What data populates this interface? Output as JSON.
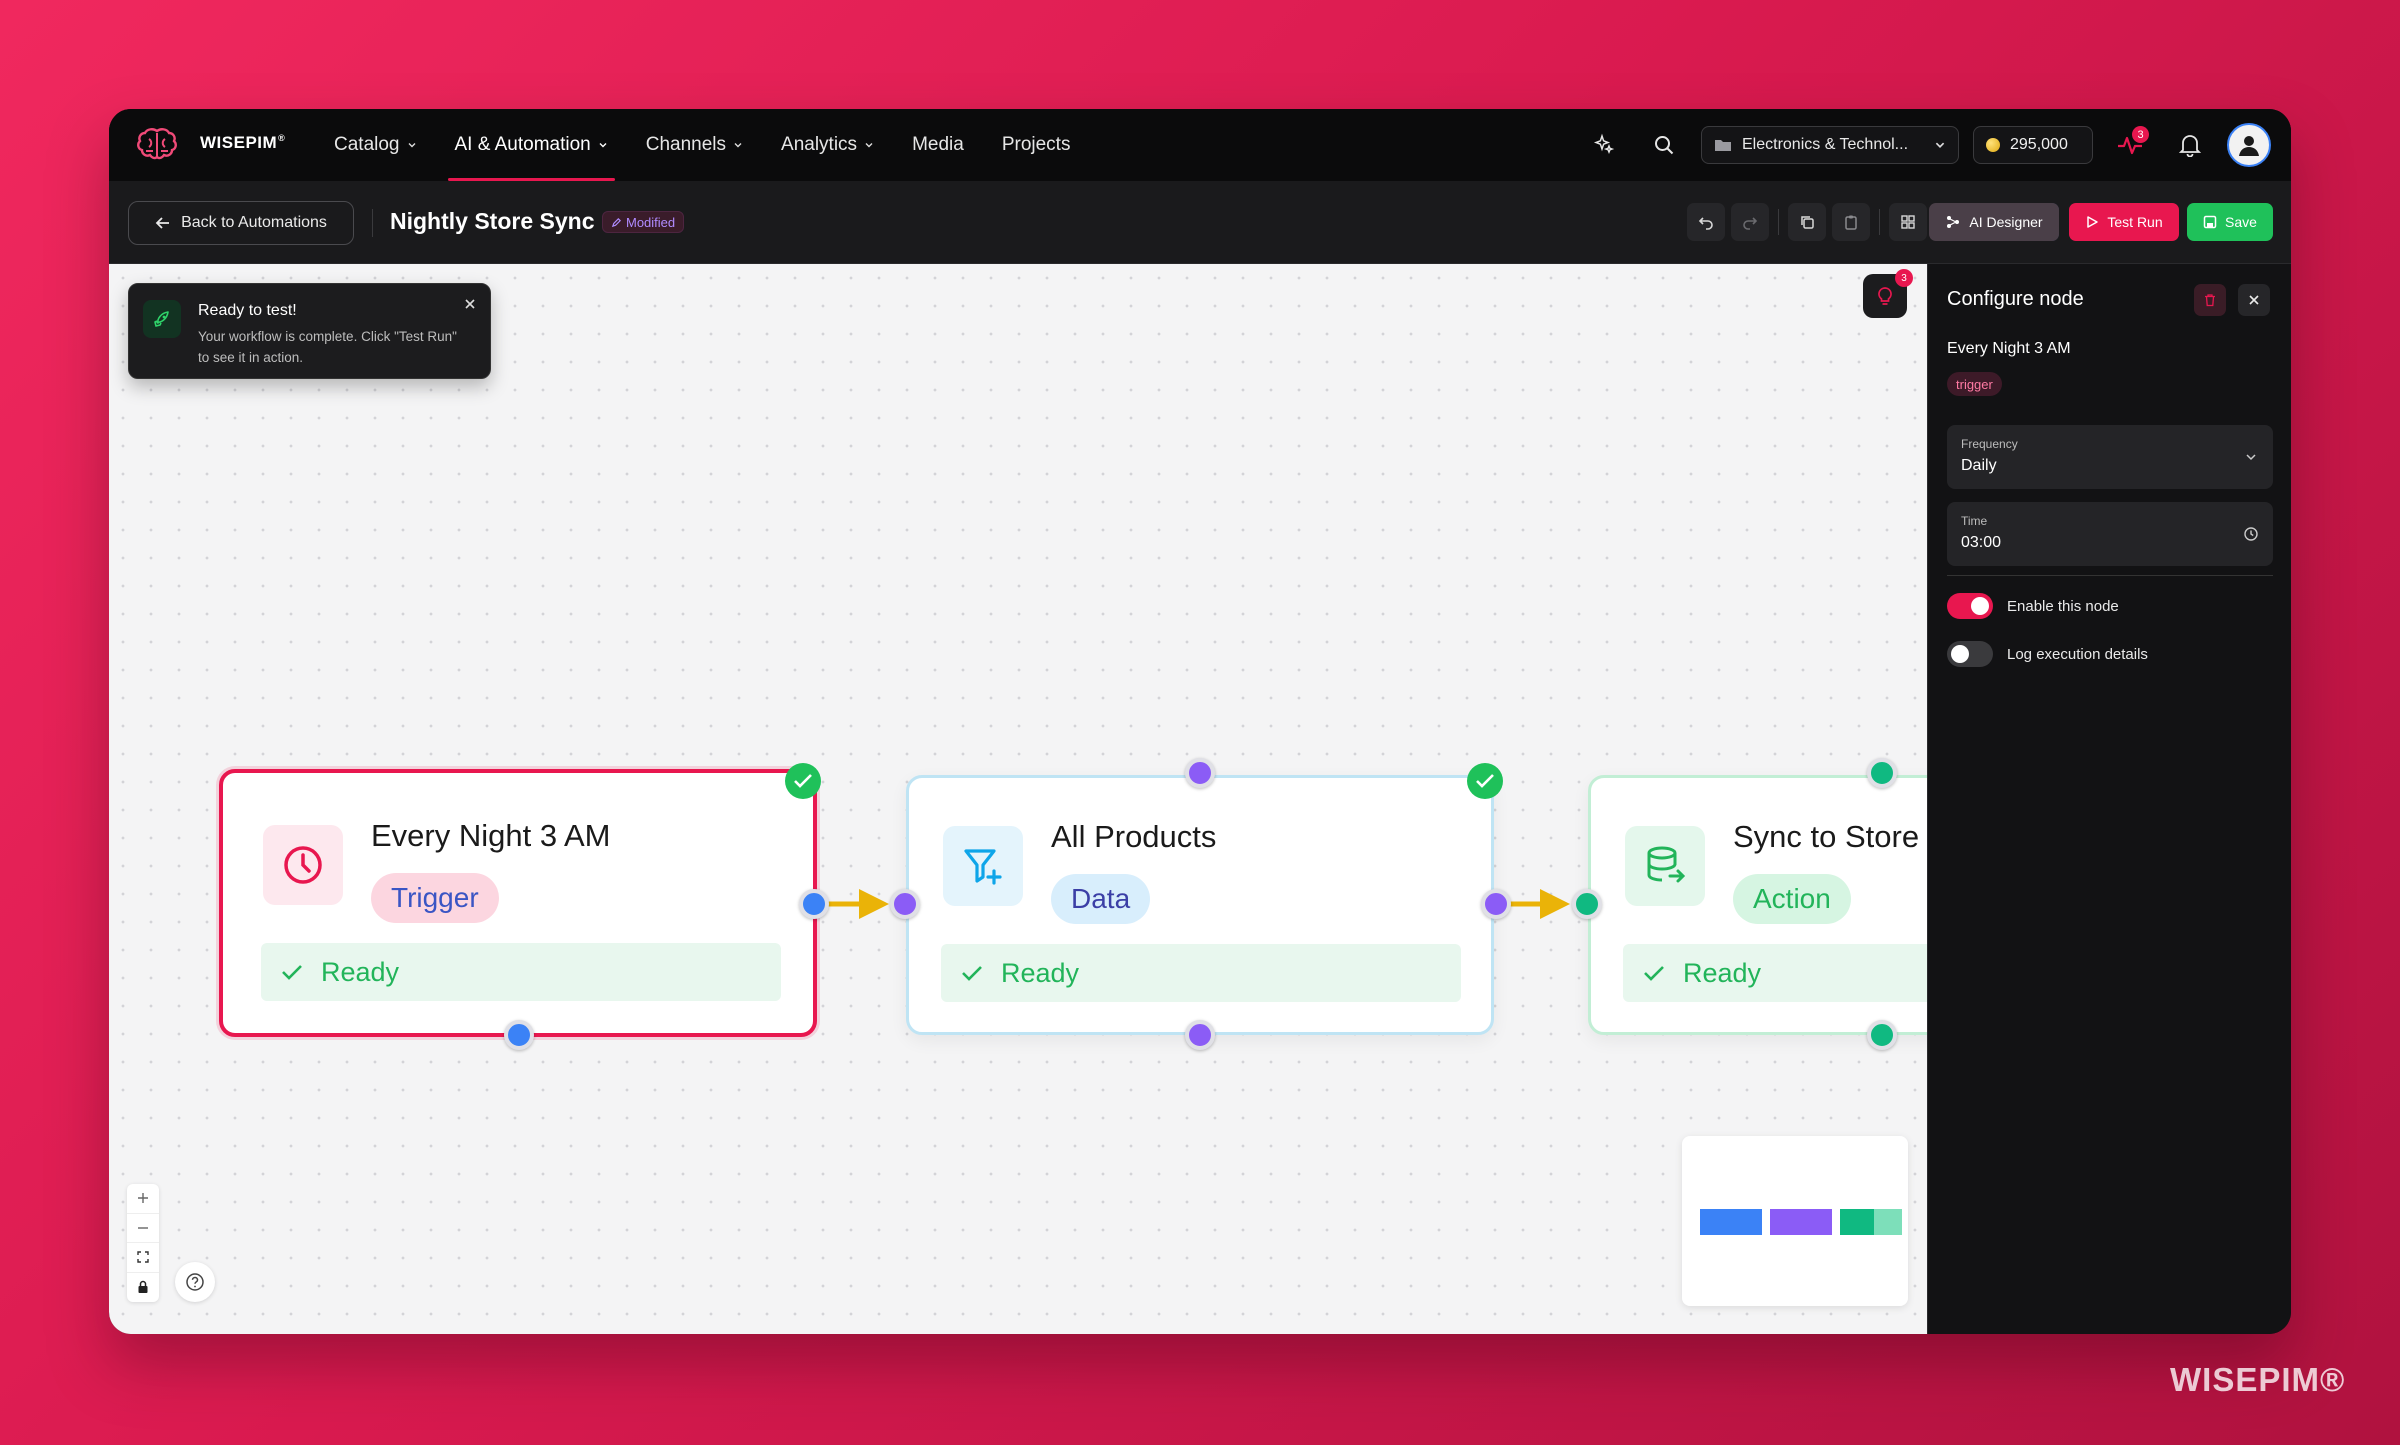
{
  "brand": {
    "name": "WISEPIM",
    "mark": "®"
  },
  "nav": {
    "items": [
      {
        "label": "Catalog",
        "dropdown": true
      },
      {
        "label": "AI & Automation",
        "dropdown": true,
        "active": true
      },
      {
        "label": "Channels",
        "dropdown": true
      },
      {
        "label": "Analytics",
        "dropdown": true
      },
      {
        "label": "Media",
        "dropdown": false
      },
      {
        "label": "Projects",
        "dropdown": false
      }
    ],
    "store_select": "Electronics & Technol...",
    "credits": "295,000",
    "activity_badge": "3"
  },
  "toolbar": {
    "back_label": "Back to Automations",
    "workflow_title": "Nightly Store Sync",
    "modified_label": "Modified",
    "ai_designer_label": "AI Designer",
    "test_run_label": "Test Run",
    "save_label": "Save"
  },
  "toast": {
    "title": "Ready to test!",
    "body": "Your workflow is complete. Click \"Test Run\" to see it in action."
  },
  "hint_badge": "3",
  "nodes": [
    {
      "title": "Every Night 3 AM",
      "tag": "Trigger",
      "status": "Ready",
      "icon": "clock-icon",
      "color": "#e8174f"
    },
    {
      "title": "All Products",
      "tag": "Data",
      "status": "Ready",
      "icon": "filter-plus-icon",
      "color": "#0ea5e9"
    },
    {
      "title": "Sync to Store",
      "tag": "Action",
      "status": "Ready",
      "icon": "database-export-icon",
      "color": "#22b45a"
    }
  ],
  "colors": {
    "accent": "#e8174f",
    "success": "#1fc15a",
    "port_blue": "#3b82f6",
    "port_purple": "#8b5cf6",
    "port_green": "#10b981",
    "edge": "#eab308"
  },
  "panel": {
    "title": "Configure node",
    "node_name": "Every Night 3 AM",
    "node_type": "trigger",
    "frequency_label": "Frequency",
    "frequency_value": "Daily",
    "time_label": "Time",
    "time_value": "03:00",
    "enable_label": "Enable this node",
    "enable_on": true,
    "log_label": "Log execution details",
    "log_on": false
  },
  "watermark": "WISEPIM®"
}
